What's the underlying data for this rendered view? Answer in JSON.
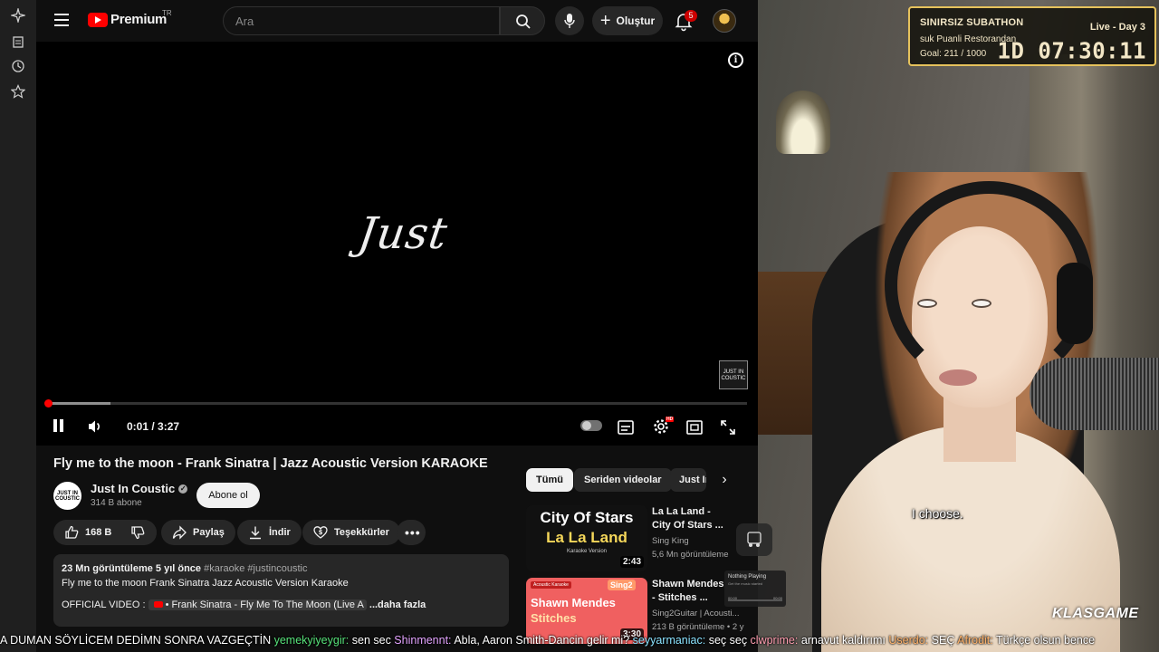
{
  "masthead": {
    "logo_text": "Premium",
    "region": "TR",
    "search_placeholder": "Ara",
    "create_label": "Oluştur",
    "notifications_count": "5"
  },
  "player": {
    "overlay_text": "Just",
    "watermark_text": "JUST IN COUSTIC",
    "time": "0:01 / 3:27",
    "progress_played": 0.005,
    "progress_loaded": 0.09,
    "hd_badge": "HD"
  },
  "video": {
    "title": "Fly me to the moon - Frank Sinatra | Jazz Acoustic Version KARAOKE",
    "channel_name": "Just In Coustic",
    "channel_avatar_text": "JUST IN COUSTIC",
    "subscribers": "314 B abone",
    "subscribe_label": "Abone ol",
    "likes": "168 B",
    "share_label": "Paylaş",
    "download_label": "İndir",
    "thanks_label": "Teşekkürler",
    "description": {
      "meta": "23 Mn görüntüleme  5 yıl önce",
      "tags": "#karaoke #justincoustic",
      "line1": "Fly me to the moon Frank Sinatra Jazz Acoustic Version Karaoke",
      "line2_prefix": "OFFICIAL VIDEO :",
      "line2_link": "• Frank Sinatra - Fly Me To The Moon (Live A",
      "more": "...daha fazla"
    }
  },
  "related": {
    "chips": [
      "Tümü",
      "Seriden videolar",
      "Just In Coustic"
    ],
    "items": [
      {
        "thumb_line1": "City Of Stars",
        "thumb_line2": "La La Land",
        "thumb_line3": "Karaoke Version",
        "duration": "2:43",
        "title": "La La Land - City Of Stars ...",
        "channel": "Sing King",
        "meta": "5,6 Mn görüntüleme"
      },
      {
        "thumb_tag": "Acoustic Karaoke",
        "thumb_logo": "Sing2",
        "thumb_line1": "Shawn Mendes",
        "thumb_line2": "Stitches",
        "duration": "3:30",
        "title": "Shawn Mendes - Stitches ...",
        "channel": "Sing2Guitar | Acousti...",
        "meta": "213 B görüntüleme • 2 y"
      }
    ]
  },
  "now_playing": {
    "title": "Nothing Playing",
    "subtitle": "Get the music started",
    "time_left": "00:00",
    "time_right": "00:00"
  },
  "subathon": {
    "title": "SINIRSIZ SUBATHON",
    "sponsor": "suk Puanli Restorandan",
    "goal": "Goal: 211 / 1000",
    "live": "Live - Day 3",
    "timer": "1D 07:30:11"
  },
  "stream": {
    "caption": "I choose.",
    "brand": "KLASGAME"
  },
  "chat_ticker": [
    {
      "user": "",
      "text": "A DUMAN SÖYLİCEM DEDİMN SONRA VAZGEÇTİN "
    },
    {
      "user": "yemekyiyeygir:",
      "text": " sen sec "
    },
    {
      "user": "Shinmennt:",
      "text": " Abla, Aaron Smith-Dancin gelir mi? "
    },
    {
      "user": "seyyarmaniac:",
      "text": " seç seç "
    },
    {
      "user": "clwprime:",
      "text": " arnavut kaldırımı "
    },
    {
      "user": "Userdo:",
      "text": " SEÇ "
    },
    {
      "user": "Afrodit:",
      "text": " Türkçe olsun bence"
    }
  ],
  "colors": {
    "brand_red": "#ff0000",
    "background": "#0f0f0f",
    "subathon_border": "#e6c25c"
  }
}
